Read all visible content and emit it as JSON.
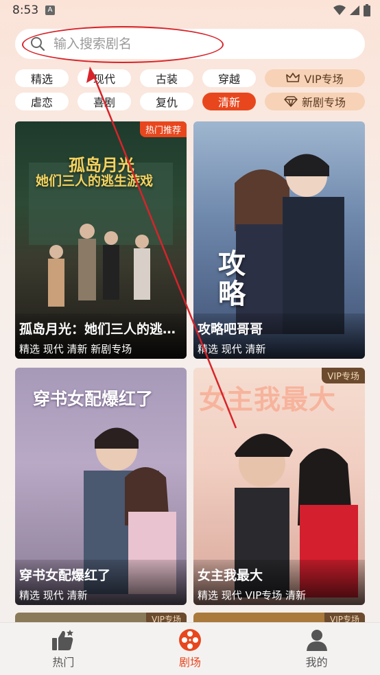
{
  "status": {
    "time": "8:53",
    "notify_glyph": "A"
  },
  "search": {
    "placeholder": "输入搜索剧名",
    "value": ""
  },
  "chips": {
    "row1": [
      "精选",
      "现代",
      "古装",
      "穿越"
    ],
    "row1_special": "VIP专场",
    "row2": [
      "虐恋",
      "喜剧",
      "复仇",
      "清新"
    ],
    "row2_special": "新剧专场",
    "active": "清新"
  },
  "cards": [
    {
      "title": "孤岛月光：她们三人的逃生游戏",
      "tags": "精选 现代 清新 新剧专场",
      "badge": "热门推荐",
      "poster_line1": "孤岛月光",
      "poster_line2": "她们三人的逃生游戏"
    },
    {
      "title": "攻略吧哥哥",
      "tags": "精选 现代 清新",
      "badge": "",
      "poster_line1": "攻略",
      "poster_line2": ""
    },
    {
      "title": "穿书女配爆红了",
      "tags": "精选 现代 清新",
      "badge": "",
      "poster_line1": "穿书女配爆红了",
      "poster_line2": ""
    },
    {
      "title": "女主我最大",
      "tags": "精选 现代 VIP专场 清新",
      "badge": "VIP专场",
      "poster_line1": "女主我最大",
      "poster_line2": ""
    }
  ],
  "peek_badges": [
    "VIP专场",
    "VIP专场"
  ],
  "nav": {
    "items": [
      "热门",
      "剧场",
      "我的"
    ],
    "active": "剧场"
  },
  "colors": {
    "accent": "#e8471e",
    "highlight": "#d8232a"
  }
}
